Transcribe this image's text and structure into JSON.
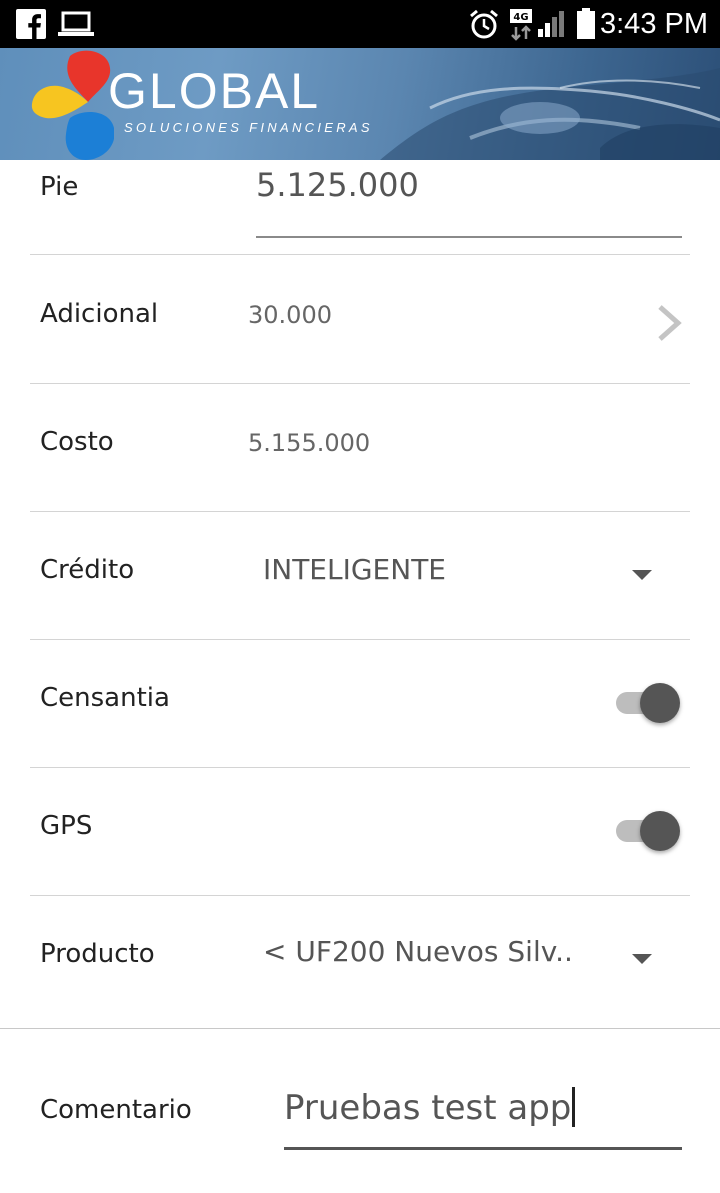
{
  "status_bar": {
    "time": "3:43 PM",
    "network_type": "4G",
    "icons": [
      "facebook-icon",
      "laptop-icon",
      "alarm-icon",
      "network-4g-icon",
      "signal-icon",
      "battery-icon"
    ]
  },
  "banner": {
    "brand": "GLOBAL",
    "tagline": "SOLUCIONES FINANCIERAS",
    "colors": {
      "red": "#e8352b",
      "yellow": "#f7c520",
      "blue": "#1c7fd6"
    }
  },
  "form": {
    "pie": {
      "label": "Pie",
      "value": "5.125.000"
    },
    "adicional": {
      "label": "Adicional",
      "value": "30.000",
      "icon": "chevron-right-icon"
    },
    "costo": {
      "label": "Costo",
      "value": "5.155.000"
    },
    "credito": {
      "label": "Crédito",
      "value": "INTELIGENTE",
      "icon": "dropdown-caret-icon"
    },
    "censantia": {
      "label": "Censantia",
      "on": true
    },
    "gps": {
      "label": "GPS",
      "on": true
    },
    "producto": {
      "label": "Producto",
      "value": "< UF200 Nuevos Silv..",
      "icon": "dropdown-caret-icon"
    },
    "comentario": {
      "label": "Comentario",
      "value": "Pruebas test app"
    }
  }
}
